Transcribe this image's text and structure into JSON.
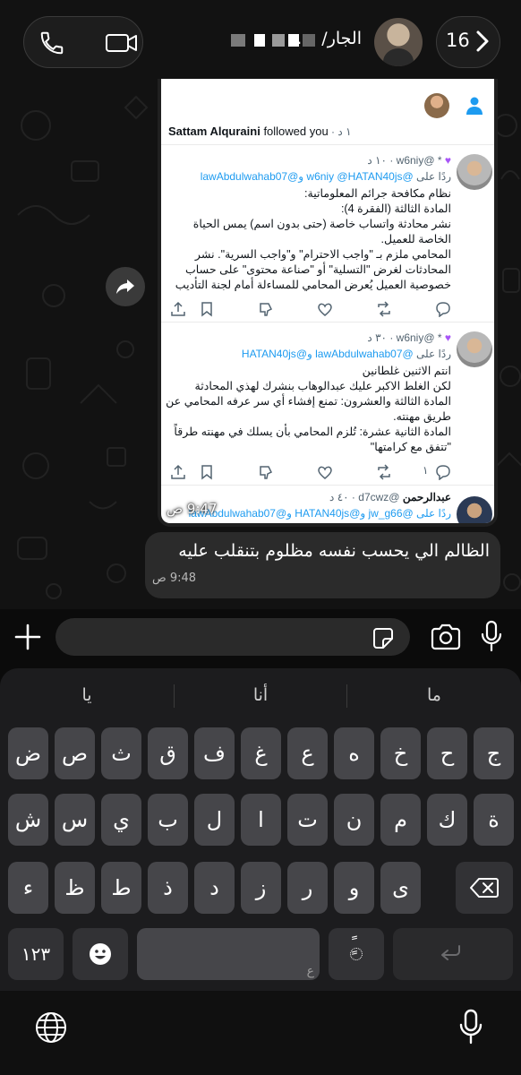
{
  "header": {
    "back_count": "16",
    "contact_name": "الجار/ ه‌..."
  },
  "image_message": {
    "time": "9:47 ص",
    "screenshot": {
      "follow": {
        "user": "Sattam Alquraini",
        "text": " followed you",
        "time": " · ١ د"
      },
      "tweet1": {
        "header": "@w6niy · ١٠ د",
        "reply_prefix": "ردًا على ",
        "reply_mentions": "@w6niy @HATAN40js و@lawAbdulwahab07",
        "lines": [
          "نظام مكافحة جرائم المعلوماتية:",
          "المادة الثالثة (الفقرة 4):",
          "نشر محادثة واتساب خاصة (حتى بدون اسم) يمس الحياة",
          "الخاصة للعميل.",
          "المحامي ملزم بـ \"واجب الاحترام\" و\"واجب السرية\". نشر",
          "المحادثات لغرض \"التسلية\" أو \"صناعة محتوى\" على حساب",
          "خصوصية العميل يُعرض المحامي للمساءلة أمام لجنة التأديب"
        ]
      },
      "tweet2": {
        "header": "@w6niy · ٣٠ د",
        "reply_prefix": "ردًا على ",
        "reply_mentions": "@lawAbdulwahab07 و@HATAN40js",
        "lines": [
          "انتم الاثنين غلطانين",
          "لكن الغلط الاكبر عليك عبدالوهاب بنشرك لهذي المحادثة",
          "المادة الثالثة والعشرون: تمنع إفشاء أي سر عرفه المحامي عن",
          "طريق مهنته.",
          "المادة الثانية عشرة: تُلزم المحامي بأن يسلك في مهنته طرقاً",
          "\"تتفق مع كرامتها\""
        ],
        "reply_count": "١"
      },
      "tweet3": {
        "name": "عبدالرحمن",
        "header": "@d7cwz · ٤٠ د",
        "reply_line": "ردًا على @jw_g66 و@HATAN40js و@lawAbdulwahab07"
      }
    }
  },
  "text_message": {
    "body": "الظالم الي يحسب نفسه مظلوم بتنقلب عليه",
    "time": "9:48 ص"
  },
  "keyboard": {
    "suggestions": [
      "يا",
      "أنا",
      "ما"
    ],
    "row1": [
      "ض",
      "ص",
      "ث",
      "ق",
      "ف",
      "غ",
      "ع",
      "ه",
      "خ",
      "ح",
      "ج"
    ],
    "row2": [
      "ش",
      "س",
      "ي",
      "ب",
      "ل",
      "ا",
      "ت",
      "ن",
      "م",
      "ك",
      "ة"
    ],
    "row3": [
      "ء",
      "ظ",
      "ط",
      "ذ",
      "د",
      "ز",
      "ر",
      "و",
      "ى"
    ],
    "numbers_key": "١٢٣",
    "space_hint": "ع",
    "diacritic_key": "ًٍ"
  }
}
